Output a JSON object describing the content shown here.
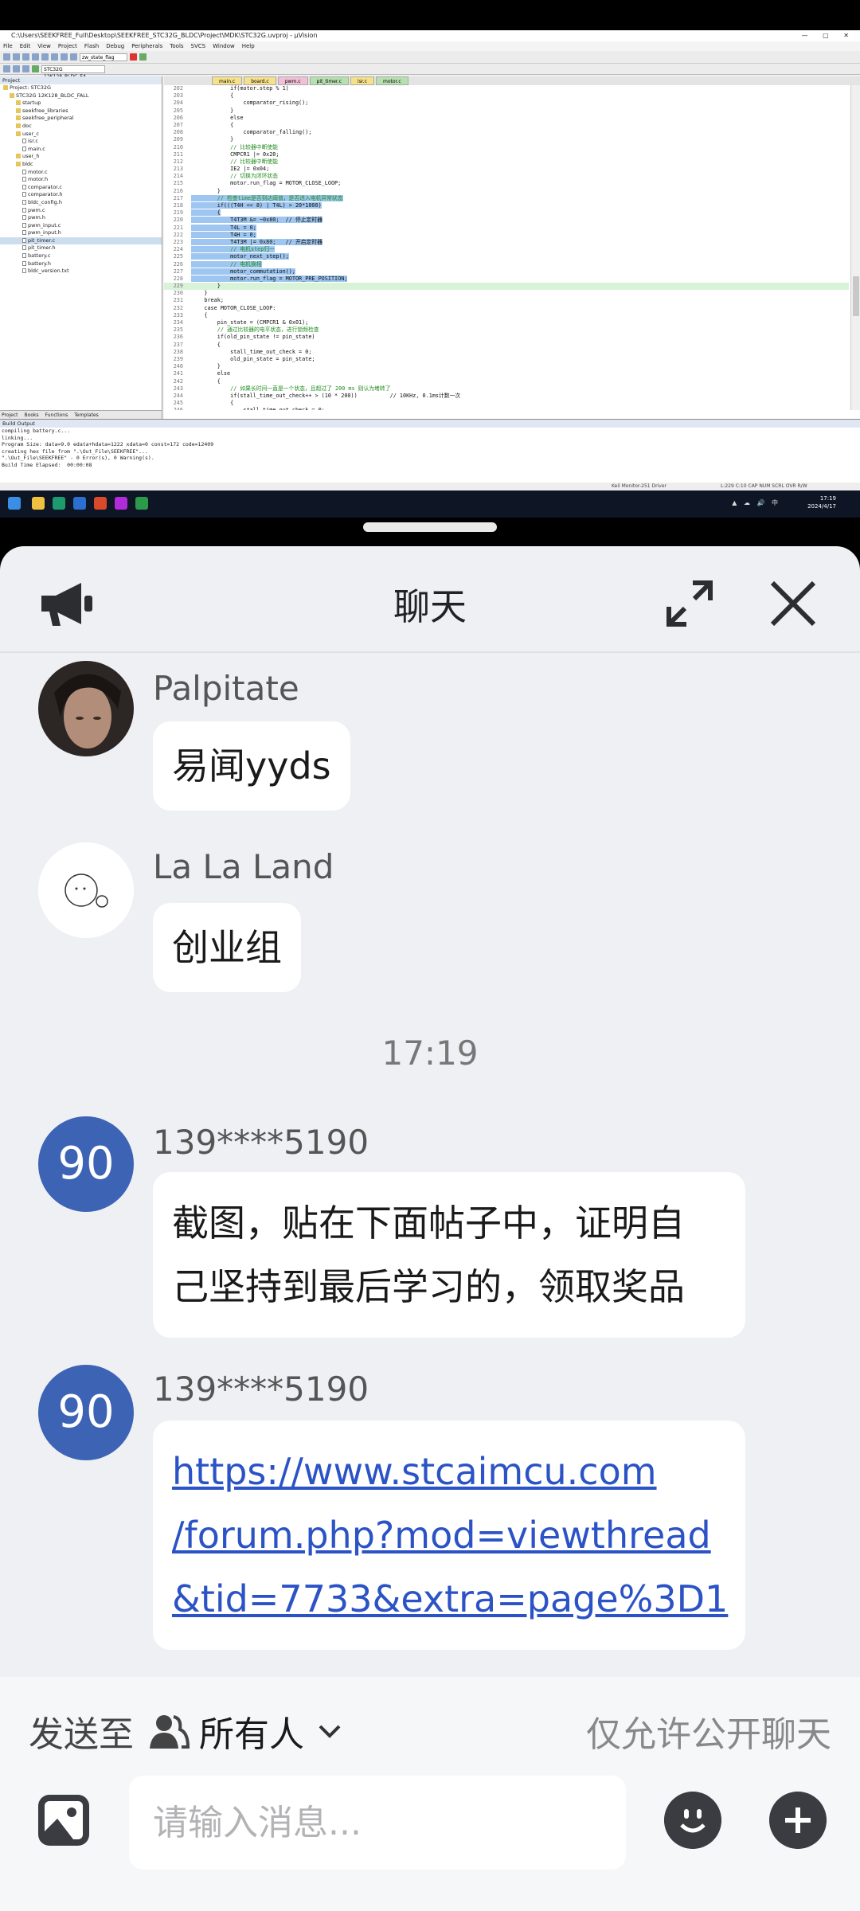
{
  "shared_screen": {
    "window_title": "C:\\Users\\SEEKFREE_Full\\Desktop\\SEEKFREE_STC32G_BLDC\\Project\\MDK\\STC32G.uvproj - µVision",
    "menu": [
      "File",
      "Edit",
      "View",
      "Project",
      "Flash",
      "Debug",
      "Peripherals",
      "Tools",
      "SVCS",
      "Window",
      "Help"
    ],
    "toolbar_target": "STC32G 12K128_BLDC_EA",
    "toolbar_search": "zw_state_flag",
    "project_header": "Project",
    "project_tree": [
      "Project: STC32G",
      "STC32G 12K128_BLDC_FALL",
      "startup",
      "seekfree_libraries",
      "seekfree_peripheral",
      "doc",
      "user_c",
      "isr.c",
      "main.c",
      "user_h",
      "bldc",
      "motor.c",
      "motor.h",
      "comparator.c",
      "comparator.h",
      "bldc_config.h",
      "pwm.c",
      "pwm.h",
      "pwm_input.c",
      "pwm_input.h",
      "pit_timer.c",
      "pit_timer.h",
      "battery.c",
      "battery.h",
      "bldc_version.txt"
    ],
    "pane_tabs": [
      "Project",
      "Books",
      "Functions",
      "Templates"
    ],
    "editor_tabs": [
      "main.c",
      "board.c",
      "pwm.c",
      "pit_timer.c",
      "isr.c",
      "motor.c"
    ],
    "code_lines": [
      {
        "n": "202",
        "t": "            if(motor.step % 1)",
        "hl": false,
        "cur": false
      },
      {
        "n": "203",
        "t": "            {",
        "hl": false,
        "cur": false
      },
      {
        "n": "204",
        "t": "                comparator_rising();",
        "hl": false,
        "cur": false
      },
      {
        "n": "205",
        "t": "            }",
        "hl": false,
        "cur": false
      },
      {
        "n": "206",
        "t": "            else",
        "hl": false,
        "cur": false
      },
      {
        "n": "207",
        "t": "            {",
        "hl": false,
        "cur": false
      },
      {
        "n": "208",
        "t": "                comparator_falling();",
        "hl": false,
        "cur": false
      },
      {
        "n": "209",
        "t": "            }",
        "hl": false,
        "cur": false
      },
      {
        "n": "210",
        "t": "            // 比较器中断使能",
        "hl": false,
        "cur": false
      },
      {
        "n": "211",
        "t": "            CMPCR1 |= 0x20;",
        "hl": false,
        "cur": false
      },
      {
        "n": "212",
        "t": "            // 比较器中断使能",
        "hl": false,
        "cur": false
      },
      {
        "n": "213",
        "t": "            IE2 |= 0x04;",
        "hl": false,
        "cur": false
      },
      {
        "n": "214",
        "t": "            // 切换为闭环状态",
        "hl": false,
        "cur": false
      },
      {
        "n": "215",
        "t": "            motor.run_flag = MOTOR_CLOSE_LOOP;",
        "hl": false,
        "cur": false
      },
      {
        "n": "216",
        "t": "        }",
        "hl": false,
        "cur": false
      },
      {
        "n": "217",
        "t": "        // 检查time是否到达阈值，是否进入电机异常状态",
        "hl": true,
        "cur": false
      },
      {
        "n": "218",
        "t": "        if(((T4H << 8) | T4L) > 20*1000)",
        "hl": true,
        "cur": false
      },
      {
        "n": "219",
        "t": "        {",
        "hl": true,
        "cur": false
      },
      {
        "n": "220",
        "t": "            T4T3M &= ~0x80;  // 停止定时器",
        "hl": true,
        "cur": false
      },
      {
        "n": "221",
        "t": "            T4L = 0;",
        "hl": true,
        "cur": false
      },
      {
        "n": "222",
        "t": "            T4H = 0;",
        "hl": true,
        "cur": false
      },
      {
        "n": "223",
        "t": "            T4T3M |= 0x80;   // 开启定时器",
        "hl": true,
        "cur": false
      },
      {
        "n": "224",
        "t": "            // 电机step归一",
        "hl": true,
        "cur": false
      },
      {
        "n": "225",
        "t": "            motor_next_step();",
        "hl": true,
        "cur": false
      },
      {
        "n": "226",
        "t": "            // 电机换相",
        "hl": true,
        "cur": false
      },
      {
        "n": "227",
        "t": "            motor_commutation();",
        "hl": true,
        "cur": false
      },
      {
        "n": "228",
        "t": "            motor.run_flag = MOTOR_PRE_POSITION;",
        "hl": true,
        "cur": false
      },
      {
        "n": "229",
        "t": "        }",
        "hl": false,
        "cur": true
      },
      {
        "n": "230",
        "t": "    }",
        "hl": false,
        "cur": false
      },
      {
        "n": "231",
        "t": "    break;",
        "hl": false,
        "cur": false
      },
      {
        "n": "232",
        "t": "    case MOTOR_CLOSE_LOOP:",
        "hl": false,
        "cur": false
      },
      {
        "n": "233",
        "t": "    {",
        "hl": false,
        "cur": false
      },
      {
        "n": "234",
        "t": "        pin_state = (CMPCR1 & 0x01);",
        "hl": false,
        "cur": false
      },
      {
        "n": "235",
        "t": "        // 通过比较器的电平状态，进行锁频检查",
        "hl": false,
        "cur": false
      },
      {
        "n": "236",
        "t": "        if(old_pin_state != pin_state)",
        "hl": false,
        "cur": false
      },
      {
        "n": "237",
        "t": "        {",
        "hl": false,
        "cur": false
      },
      {
        "n": "238",
        "t": "            stall_time_out_check = 0;",
        "hl": false,
        "cur": false
      },
      {
        "n": "239",
        "t": "            old_pin_state = pin_state;",
        "hl": false,
        "cur": false
      },
      {
        "n": "240",
        "t": "        }",
        "hl": false,
        "cur": false
      },
      {
        "n": "241",
        "t": "        else",
        "hl": false,
        "cur": false
      },
      {
        "n": "242",
        "t": "        {",
        "hl": false,
        "cur": false
      },
      {
        "n": "243",
        "t": "            // 如果长时间一直是一个状态，且超过了 200 ms 则认为堵转了",
        "hl": false,
        "cur": false
      },
      {
        "n": "244",
        "t": "            if(stall_time_out_check++ > (10 * 200))          // 10KHz, 0.1ms计数一次",
        "hl": false,
        "cur": false
      },
      {
        "n": "245",
        "t": "            {",
        "hl": false,
        "cur": false
      },
      {
        "n": "246",
        "t": "                stall_time_out_check = 0;",
        "hl": false,
        "cur": false
      }
    ],
    "build_header": "Build Output",
    "build_lines": [
      "compiling battery.c...",
      "linking...",
      "Program Size: data=9.0 edata+hdata=1222 xdata=0 const=172 code=12409",
      "creating hex file from \".\\Out_File\\SEEKFREE\"...",
      "\".\\Out_File\\SEEKFREE\" - 0 Error(s), 0 Warning(s).",
      "Build Time Elapsed:  00:00:08"
    ],
    "status_debugger": "Keil Monitor-251 Driver",
    "status_pos": "L:229 C:10",
    "status_caps": "CAP  NUM  SCRL  OVR  R/W",
    "clock_time": "17:19",
    "clock_date": "2024/4/17",
    "tray_lang": "中"
  },
  "chat": {
    "title": "聊天",
    "messages": [
      {
        "sender": "Palpitate",
        "lines": [
          "易闻yyds"
        ],
        "avatar_type": "photo"
      },
      {
        "sender": "La La Land",
        "lines": [
          "创业组"
        ],
        "avatar_type": "sketch"
      }
    ],
    "time_separator": "17:19",
    "later_messages": [
      {
        "sender": "139****5190",
        "avatar_text": "90",
        "lines": [
          "截图，贴在下面帖子中，证明自",
          "己坚持到最后学习的，领取奖品"
        ]
      },
      {
        "sender": "139****5190",
        "avatar_text": "90",
        "link_lines": [
          "https://www.stcaimcu.com",
          "/forum.php?mod=viewthread",
          "&tid=7733&extra=page%3D1"
        ]
      }
    ],
    "footer": {
      "send_to_label": "发送至",
      "recipient": "所有人",
      "public_only": "仅允许公开聊天",
      "input_placeholder": "请输入消息..."
    },
    "colors": {
      "avatar_blue": "#3d63b5",
      "link_blue": "#2b53c5",
      "sheet_bg": "#eef0f4"
    }
  }
}
